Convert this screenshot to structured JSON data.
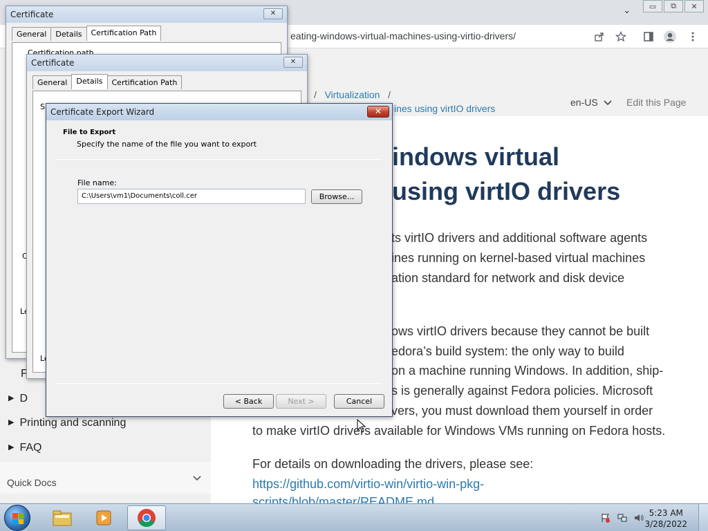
{
  "browser": {
    "url_visible": "eating-windows-virtual-machines-using-virtio-drivers/",
    "win_minimize": "▭",
    "win_restore": "⧉",
    "win_close": "✕",
    "tab_menu": "⌄"
  },
  "page": {
    "breadcrumb_sep1": "/",
    "breadcrumb_link": "Virtualization",
    "breadcrumb_sep2": "/",
    "breadcrumb_current": "ines using virtIO drivers",
    "language": "en-US",
    "edit_page": "Edit this Page",
    "title_line1": "indows virtual",
    "title_line2": "using virtIO drivers",
    "paragraph1": [
      "ts virtIO drivers and additional software agents",
      "ines running on kernel-based virtual machines",
      "ation standard for network and disk device"
    ],
    "paragraph2": [
      "ows virtIO drivers because they cannot be built",
      "edora’s build system: the only way to build",
      "on a machine running Windows. In addition, ship-",
      "s is generally against Fedora policies. Microsoft",
      "vers, you must download them yourself in order",
      "to make virtIO drivers available for Windows VMs running on Fedora hosts."
    ],
    "details_text": "For details on downloading the drivers, please see:",
    "details_link_line1": "https://github.com/virtio-win/virtio-win-pkg-",
    "details_link_line2": "scripts/blob/master/README.md"
  },
  "sidebar": {
    "items": [
      {
        "label": "F",
        "has_arrow": false
      },
      {
        "label": "D",
        "has_arrow": true
      },
      {
        "label": "Printing and scanning",
        "has_arrow": true
      },
      {
        "label": "FAQ",
        "has_arrow": true
      }
    ],
    "quick_docs": "Quick Docs"
  },
  "cert_dialog_back": {
    "title": "Certificate",
    "close": "✕",
    "tabs": [
      "General",
      "Details",
      "Certification Path"
    ],
    "active_tab": "Certification Path",
    "partial_label": "Certification path",
    "fragment_c": "C",
    "fragment_le": "Le"
  },
  "cert_dialog_mid": {
    "title": "Certificate",
    "close": "✕",
    "tabs": [
      "General",
      "Details",
      "Certification Path"
    ],
    "active_tab": "Details",
    "fragment_s": "S",
    "fragment_le": "Le"
  },
  "wizard": {
    "title": "Certificate Export Wizard",
    "close": "✕",
    "heading": "File to Export",
    "subheading": "Specify the name of the file you want to export",
    "file_name_label": "File name:",
    "file_name_value": "C:\\Users\\vm1\\Documents\\coll.cer",
    "browse_button": "Browse...",
    "back_button": "< Back",
    "next_button": "Next >",
    "cancel_button": "Cancel"
  },
  "taskbar": {
    "time": "5:23 AM",
    "date": "3/28/2022"
  }
}
